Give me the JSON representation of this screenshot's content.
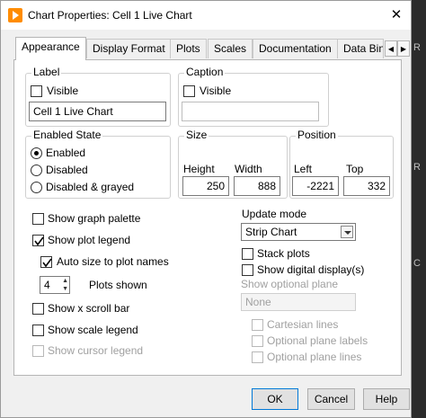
{
  "window": {
    "title": "Chart Properties: Cell 1 Live Chart"
  },
  "tabs": [
    {
      "label": "Appearance"
    },
    {
      "label": "Display Format"
    },
    {
      "label": "Plots"
    },
    {
      "label": "Scales"
    },
    {
      "label": "Documentation"
    },
    {
      "label": "Data Bin"
    }
  ],
  "label_group": {
    "legend": "Label",
    "visible_label": "Visible",
    "visible_checked": false,
    "value": "Cell 1 Live Chart"
  },
  "caption_group": {
    "legend": "Caption",
    "visible_label": "Visible",
    "visible_checked": false,
    "value": ""
  },
  "enabled_state": {
    "legend": "Enabled State",
    "options": [
      "Enabled",
      "Disabled",
      "Disabled & grayed"
    ],
    "selected": "Enabled"
  },
  "size": {
    "legend": "Size",
    "height_label": "Height",
    "height": "250",
    "width_label": "Width",
    "width": "888"
  },
  "position": {
    "legend": "Position",
    "left_label": "Left",
    "left": "-2221",
    "top_label": "Top",
    "top": "332"
  },
  "options": {
    "show_graph_palette": {
      "label": "Show graph palette",
      "checked": false
    },
    "show_plot_legend": {
      "label": "Show plot legend",
      "checked": true
    },
    "auto_size": {
      "label": "Auto size to plot names",
      "checked": true
    },
    "plots_shown": {
      "label": "Plots shown",
      "value": "4"
    },
    "show_x_scroll": {
      "label": "Show x scroll bar",
      "checked": false
    },
    "show_scale_legend": {
      "label": "Show scale legend",
      "checked": false
    },
    "show_cursor_legend": {
      "label": "Show cursor legend",
      "checked": false
    }
  },
  "update_mode": {
    "label": "Update mode",
    "value": "Strip Chart"
  },
  "right_options": {
    "stack_plots": {
      "label": "Stack plots",
      "checked": false
    },
    "show_digital": {
      "label": "Show digital display(s)",
      "checked": false
    },
    "optional_plane_label": "Show optional plane",
    "optional_plane_value": "None",
    "cartesian": {
      "label": "Cartesian lines",
      "checked": false
    },
    "plane_labels": {
      "label": "Optional plane labels",
      "checked": false
    },
    "plane_lines": {
      "label": "Optional plane lines",
      "checked": false
    }
  },
  "buttons": {
    "ok": "OK",
    "cancel": "Cancel",
    "help": "Help"
  },
  "colors": {
    "accent": "#0078d7",
    "app_icon": "#ff8c00"
  }
}
